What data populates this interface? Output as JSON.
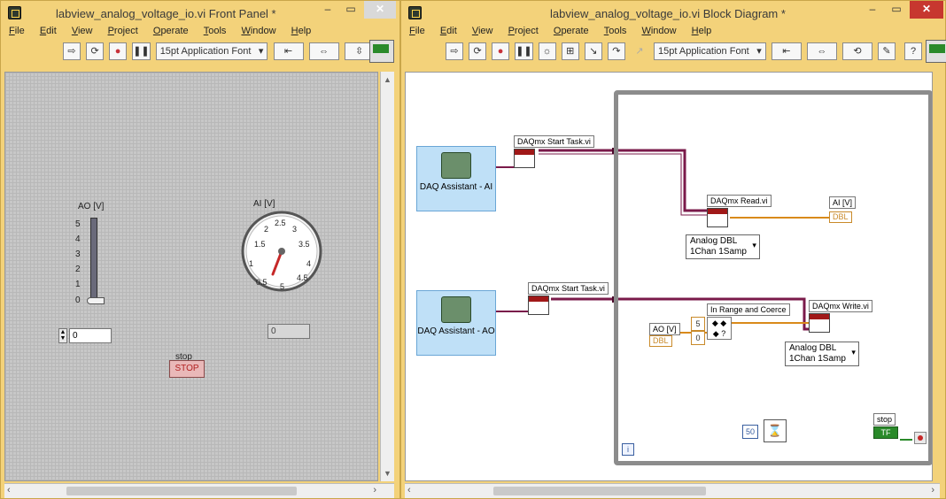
{
  "front_panel": {
    "title": "labview_analog_voltage_io.vi Front Panel *",
    "menu": [
      "File",
      "Edit",
      "View",
      "Project",
      "Operate",
      "Tools",
      "Window",
      "Help"
    ],
    "font_label": "15pt Application Font",
    "ao_label": "AO [V]",
    "ao_scale": [
      "5",
      "4",
      "3",
      "2",
      "1",
      "0"
    ],
    "ao_value": "0",
    "ai_label": "AI [V]",
    "ai_scale": [
      "0.5",
      "1",
      "1.5",
      "2",
      "2.5",
      "3",
      "3.5",
      "4",
      "4.5",
      "5"
    ],
    "ai_value": "0",
    "stop_label": "stop",
    "stop_button": "STOP"
  },
  "block_diagram": {
    "title": "labview_analog_voltage_io.vi Block Diagram *",
    "menu": [
      "File",
      "Edit",
      "View",
      "Project",
      "Operate",
      "Tools",
      "Window",
      "Help"
    ],
    "font_label": "15pt Application Font",
    "daq_ai": "DAQ Assistant - AI",
    "daq_ao": "DAQ Assistant - AO",
    "start_task_1": "DAQmx Start Task.vi",
    "start_task_2": "DAQmx Start Task.vi",
    "read_vi": "DAQmx Read.vi",
    "write_vi": "DAQmx Write.vi",
    "in_range": "In Range and Coerce",
    "ai_indicator": "AI [V]",
    "ai_indicator_type": "DBL",
    "ao_control": "AO [V]",
    "ao_control_type": "DBL",
    "read_mode_1": "Analog DBL",
    "read_mode_2": "1Chan 1Samp",
    "write_mode_1": "Analog DBL",
    "write_mode_2": "1Chan 1Samp",
    "const_upper": "5",
    "const_lower": "0",
    "wait_const": "50",
    "stop_terminal": "stop",
    "stop_type": "TF",
    "loop_iteration": "i"
  },
  "colors": {
    "window_frame": "#f3d27a",
    "close_button": "#c7372f",
    "daq_block": "#bfe0f7",
    "error_wire": "#7a1a4a",
    "data_wire": "#d98a1a"
  }
}
